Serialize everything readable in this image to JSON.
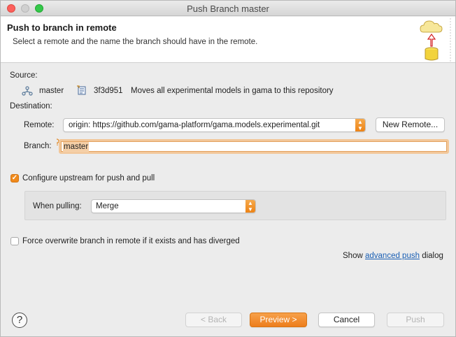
{
  "window": {
    "title": "Push Branch master"
  },
  "banner": {
    "title": "Push to branch in remote",
    "description": "Select a remote and the name the branch should have in the remote."
  },
  "source": {
    "label": "Source:",
    "branch": "master",
    "commit_id": "3f3d951",
    "commit_message": "Moves all experimental models in gama to this repository"
  },
  "destination": {
    "label": "Destination:",
    "remote_label": "Remote:",
    "remote_value": "origin: https://github.com/gama-platform/gama.models.experimental.git",
    "new_remote_button": "New Remote...",
    "branch_label": "Branch:",
    "branch_value": "master"
  },
  "upstream": {
    "checkbox_label": "Configure upstream for push and pull",
    "checked": true,
    "when_pulling_label": "When pulling:",
    "when_pulling_value": "Merge"
  },
  "force": {
    "checkbox_label": "Force overwrite branch in remote if it exists and has diverged",
    "checked": false
  },
  "advanced": {
    "prefix": "Show",
    "link": "advanced push",
    "suffix": "dialog"
  },
  "footer": {
    "help": "?",
    "back": "< Back",
    "preview": "Preview >",
    "cancel": "Cancel",
    "push": "Push"
  },
  "colors": {
    "accent": "#ed8315",
    "link": "#1a5fb4"
  }
}
